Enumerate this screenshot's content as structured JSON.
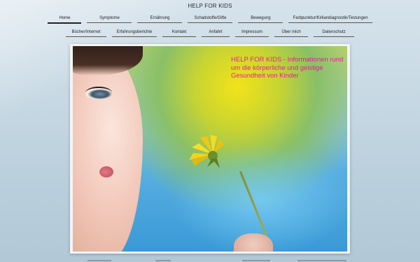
{
  "site": {
    "title": "HELP FOR KIDS"
  },
  "nav": {
    "row1": [
      {
        "label": "Home",
        "active": true
      },
      {
        "label": "Symptome"
      },
      {
        "label": "Ernährung"
      },
      {
        "label": "Schadstoffe/Gifte"
      },
      {
        "label": "Bewegung"
      },
      {
        "label": "Farbpunktur/Kirliandiagnostik/Testungen"
      }
    ],
    "row2": [
      {
        "label": "Bücher/Internet"
      },
      {
        "label": "Erfahrungsberichte"
      },
      {
        "label": "Kontakt"
      },
      {
        "label": "Anfahrt"
      },
      {
        "label": "Impressum"
      },
      {
        "label": "Über mich"
      },
      {
        "label": "Datenschutz"
      }
    ]
  },
  "hero": {
    "headline": "HELP FOR KIDS - Informationen rund um die körperliche und geistige Gesundheit von Kinder",
    "image": "girl-blowing-dandelion-photo",
    "headline_color": "#e0208f"
  }
}
